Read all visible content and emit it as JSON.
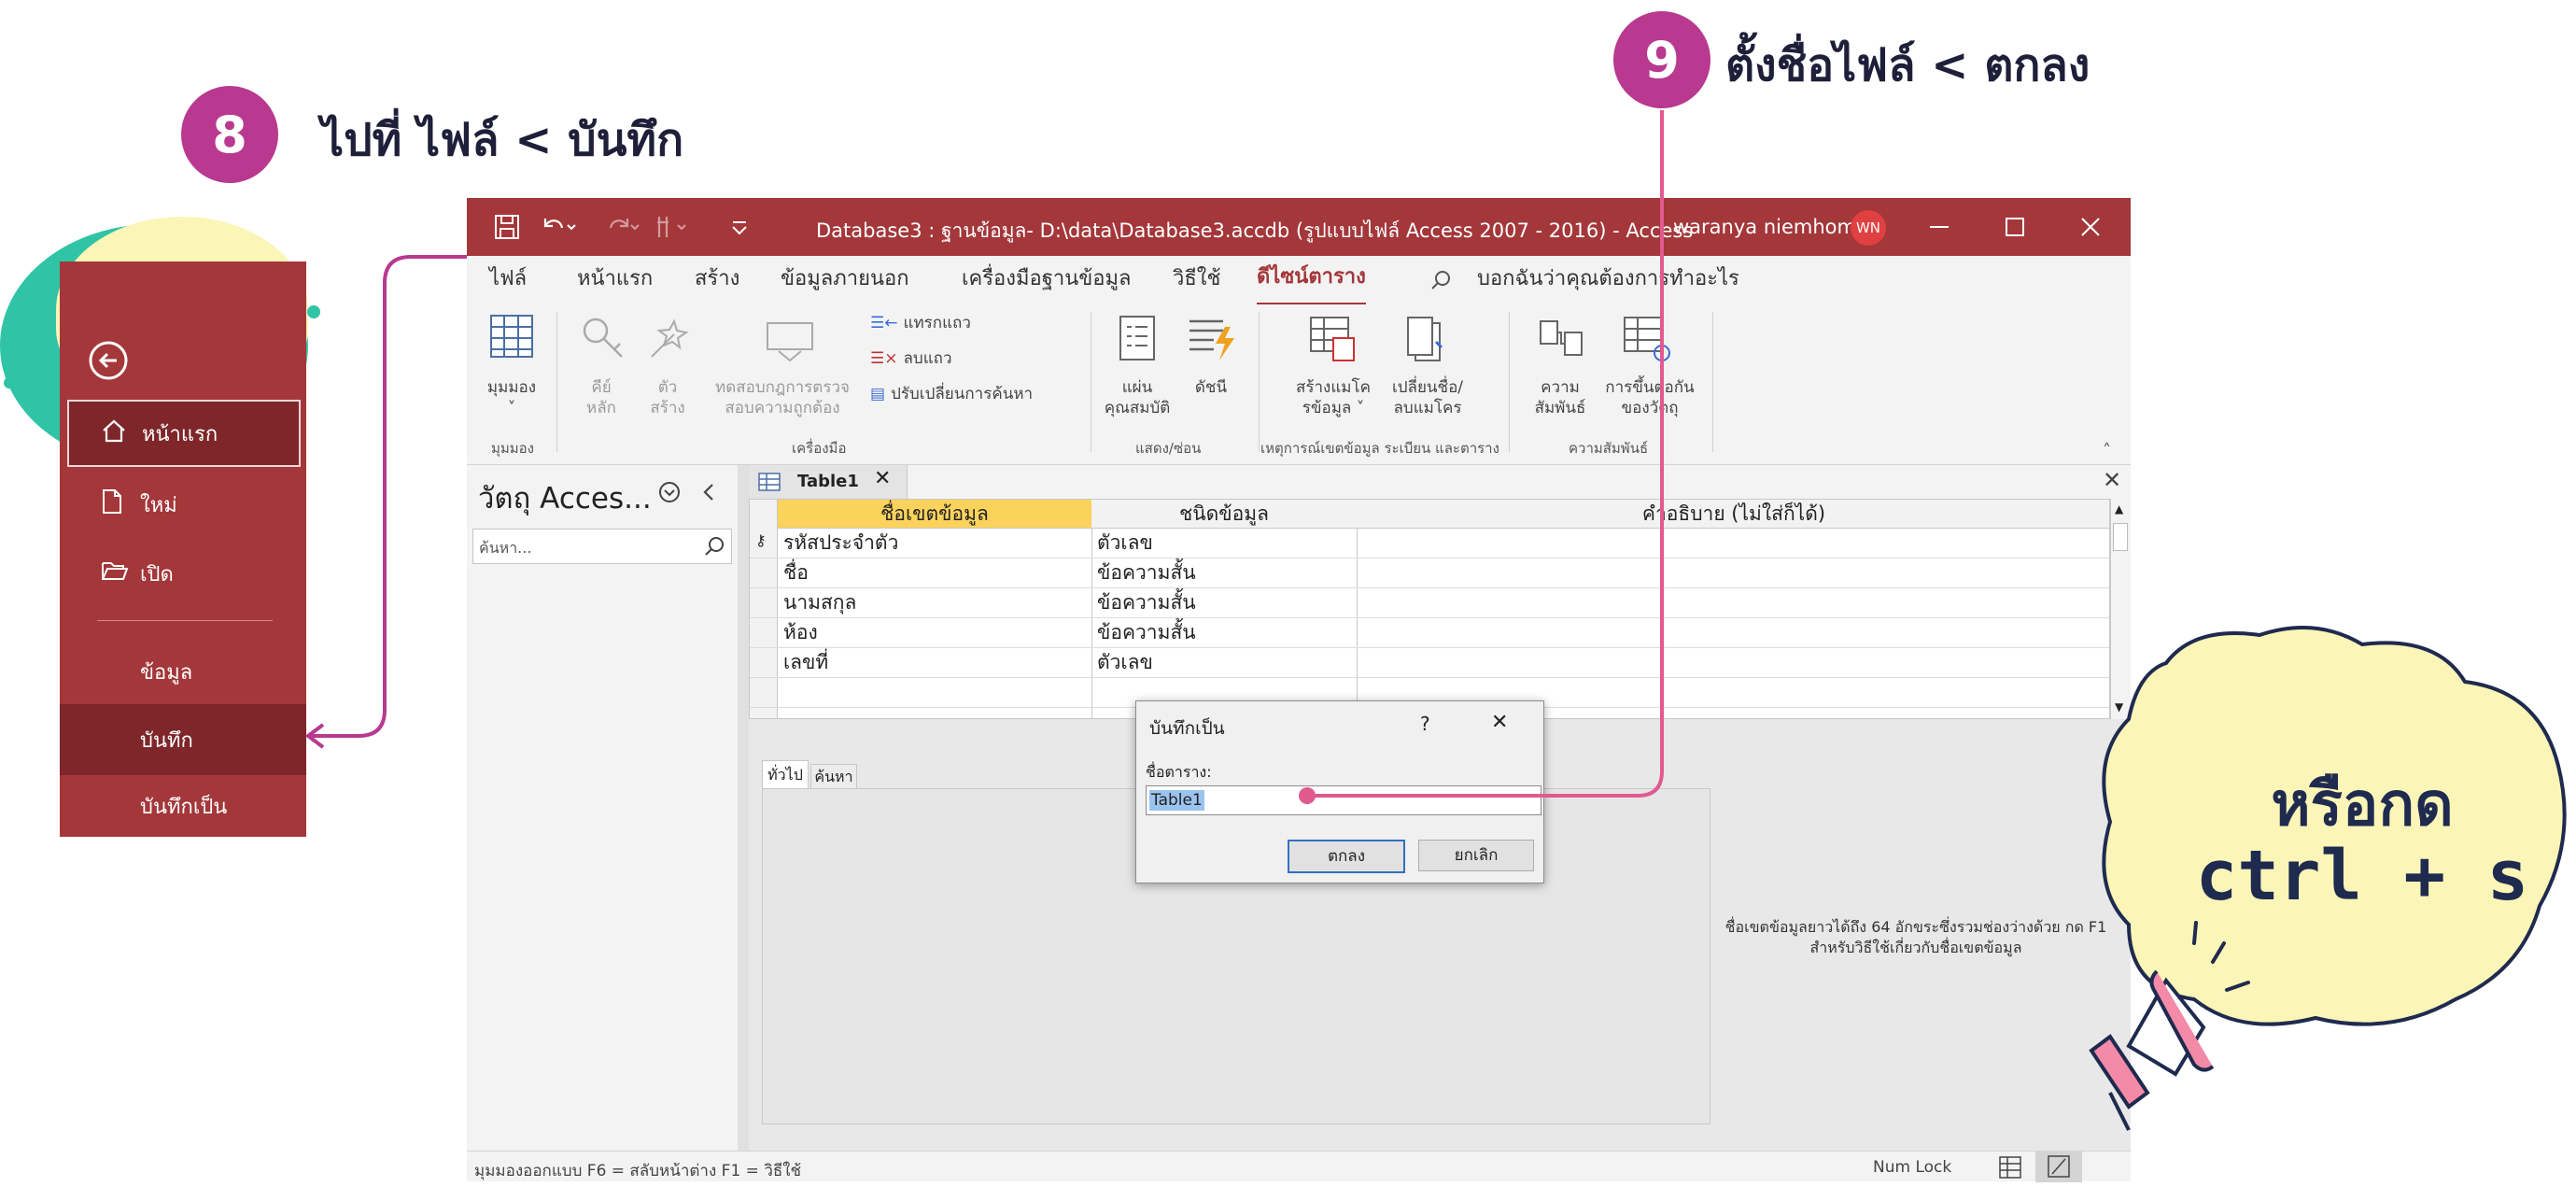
{
  "steps": {
    "step8": {
      "number": "8",
      "text": "ไปที่ ไฟล์ < บันทึก"
    },
    "step9": {
      "number": "9",
      "text": "ตั้งชื่อไฟล์ < ตกลง"
    }
  },
  "backstage": {
    "items": [
      {
        "label": "หน้าแรก",
        "icon": "home-icon"
      },
      {
        "label": "ใหม่",
        "icon": "new-file-icon"
      },
      {
        "label": "เปิด",
        "icon": "open-folder-icon"
      },
      {
        "label": "ข้อมูล"
      },
      {
        "label": "บันทึก"
      },
      {
        "label": "บันทึกเป็น"
      }
    ]
  },
  "window": {
    "title": "Database3 : ฐานข้อมูล- D:\\data\\Database3.accdb (รูปแบบไฟล์ Access 2007 - 2016)  -  Access",
    "user": "waranya niemhom",
    "user_initials": "WN"
  },
  "tabs": [
    "ไฟล์",
    "หน้าแรก",
    "สร้าง",
    "ข้อมูลภายนอก",
    "เครื่องมือฐานข้อมูล",
    "วิธีใช้",
    "ดีไซน์ตาราง"
  ],
  "tellme": "บอกฉันว่าคุณต้องการทำอะไร",
  "ribbon": {
    "view_line1": "มุมมอง",
    "key_line1": "คีย์",
    "key_line2": "หลัก",
    "builder_line1": "ตัว",
    "builder_line2": "สร้าง",
    "test_line1": "ทดสอบกฎการตรวจ",
    "test_line2": "สอบความถูกต้อง",
    "insert_rows": "แทรกแถว",
    "delete_rows": "ลบแถว",
    "modify_lookups": "ปรับเปลี่ยนการค้นหา",
    "property_line1": "แผ่น",
    "property_line2": "คุณสมบัติ",
    "indexes": "ดัชนี",
    "create_macro_line1": "สร้างแมโค",
    "create_macro_line2": "รข้อมูล ˅",
    "rename_macro_line1": "เปลี่ยนชื่อ/",
    "rename_macro_line2": "ลบแมโคร",
    "rel_line1": "ความ",
    "rel_line2": "สัมพันธ์",
    "dep_line1": "การขึ้นต่อกัน",
    "dep_line2": "ของวัตถุ",
    "groups": [
      "มุมมอง",
      "เครื่องมือ",
      "แสดง/ซ่อน",
      "เหตุการณ์เขตข้อมูล ระเบียน และตาราง",
      "ความสัมพันธ์"
    ]
  },
  "nav_pane": {
    "title": "วัตถุ Acces...",
    "search_placeholder": "ค้นหา..."
  },
  "table_tab": "Table1",
  "design_grid": {
    "headers": [
      "ชื่อเขตข้อมูล",
      "ชนิดข้อมูล",
      "คำอธิบาย (ไม่ใส่ก็ได้)"
    ],
    "rows": [
      {
        "field": "รหัสประจำตัว",
        "type": "ตัวเลข"
      },
      {
        "field": "ชื่อ",
        "type": "ข้อความสั้น"
      },
      {
        "field": "นามสกุล",
        "type": "ข้อความสั้น"
      },
      {
        "field": "ห้อง",
        "type": "ข้อความสั้น"
      },
      {
        "field": "เลขที่",
        "type": "ตัวเลข"
      }
    ]
  },
  "properties": {
    "tabs": [
      "ทั่วไป",
      "ค้นหา"
    ],
    "help_text": "ชื่อเขตข้อมูลยาวได้ถึง 64 อักขระซึ่งรวมช่องว่างด้วย กด F1 สำหรับวิธีใช้เกี่ยวกับชื่อเขตข้อมูล"
  },
  "dialog": {
    "title": "บันทึกเป็น",
    "help": "?",
    "label": "ชื่อตาราง:",
    "value": "Table1",
    "ok": "ตกลง",
    "cancel": "ยกเลิก"
  },
  "statusbar": {
    "left": "มุมมองออกแบบ  F6 = สลับหน้าต่าง  F1 = วิธีใช้",
    "numlock": "Num Lock"
  },
  "callout": {
    "line1": "หรือกด",
    "line2": "ctrl + s"
  },
  "colors": {
    "access_red": "#a4373a",
    "badge_magenta": "#b8398f",
    "callout_yellow": "#fbf5b7",
    "teal": "#2fc4a5"
  }
}
